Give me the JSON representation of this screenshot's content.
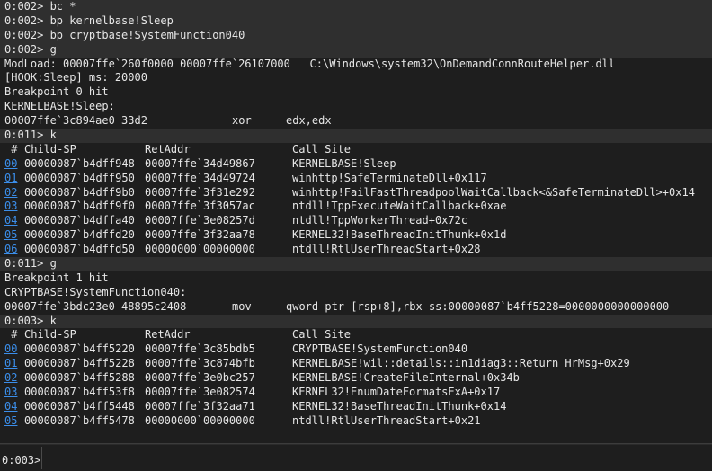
{
  "output": {
    "cmd_bc": "0:002> bc *",
    "cmd_bp_sleep": "0:002> bp kernelbase!Sleep",
    "cmd_bp_sysfunc": "0:002> bp cryptbase!SystemFunction040",
    "cmd_g1": "0:002> g",
    "modload": "ModLoad: 00007ffe`260f0000 00007ffe`26107000   C:\\Windows\\system32\\OnDemandConnRouteHelper.dll",
    "hook_sleep": "[HOOK:Sleep] ms: 20000",
    "bp0_hit": "Breakpoint 0 hit",
    "sleep_symbol": "KERNELBASE!Sleep:",
    "disasm1": {
      "address": "00007ffe`3c894ae0 33d2",
      "mnemonic": "xor",
      "operands": "edx,edx"
    },
    "cmd_k1": "0:011> k",
    "cmd_g2": "0:011> g",
    "bp1_hit": "Breakpoint 1 hit",
    "sysfunc_symbol": "CRYPTBASE!SystemFunction040:",
    "disasm2": {
      "address": "00007ffe`3bdc23e0 48895c2408",
      "mnemonic": "mov",
      "operands": "qword ptr [rsp+8],rbx ss:00000087`b4ff5228=0000000000000000"
    },
    "cmd_k2": "0:003> k"
  },
  "stack1": {
    "headers": {
      "num": " #",
      "child_sp": "Child-SP",
      "ret_addr": "RetAddr",
      "call_site": "Call Site"
    },
    "frames": [
      {
        "num": "00",
        "child_sp": "00000087`b4dff948",
        "ret_addr": "00007ffe`34d49867",
        "call_site": "KERNELBASE!Sleep"
      },
      {
        "num": "01",
        "child_sp": "00000087`b4dff950",
        "ret_addr": "00007ffe`34d49724",
        "call_site": "winhttp!SafeTerminateDll+0x117"
      },
      {
        "num": "02",
        "child_sp": "00000087`b4dff9b0",
        "ret_addr": "00007ffe`3f31e292",
        "call_site": "winhttp!FailFastThreadpoolWaitCallback<&SafeTerminateDll>+0x14"
      },
      {
        "num": "03",
        "child_sp": "00000087`b4dff9f0",
        "ret_addr": "00007ffe`3f3057ac",
        "call_site": "ntdll!TppExecuteWaitCallback+0xae"
      },
      {
        "num": "04",
        "child_sp": "00000087`b4dffa40",
        "ret_addr": "00007ffe`3e08257d",
        "call_site": "ntdll!TppWorkerThread+0x72c"
      },
      {
        "num": "05",
        "child_sp": "00000087`b4dffd20",
        "ret_addr": "00007ffe`3f32aa78",
        "call_site": "KERNEL32!BaseThreadInitThunk+0x1d"
      },
      {
        "num": "06",
        "child_sp": "00000087`b4dffd50",
        "ret_addr": "00000000`00000000",
        "call_site": "ntdll!RtlUserThreadStart+0x28"
      }
    ]
  },
  "stack2": {
    "headers": {
      "num": " #",
      "child_sp": "Child-SP",
      "ret_addr": "RetAddr",
      "call_site": "Call Site"
    },
    "frames": [
      {
        "num": "00",
        "child_sp": "00000087`b4ff5220",
        "ret_addr": "00007ffe`3c85bdb5",
        "call_site": "CRYPTBASE!SystemFunction040"
      },
      {
        "num": "01",
        "child_sp": "00000087`b4ff5228",
        "ret_addr": "00007ffe`3c874bfb",
        "call_site": "KERNELBASE!wil::details::in1diag3::Return_HrMsg+0x29"
      },
      {
        "num": "02",
        "child_sp": "00000087`b4ff5288",
        "ret_addr": "00007ffe`3e0bc257",
        "call_site": "KERNELBASE!CreateFileInternal+0x34b"
      },
      {
        "num": "03",
        "child_sp": "00000087`b4ff53f8",
        "ret_addr": "00007ffe`3e082574",
        "call_site": "KERNEL32!EnumDateFormatsExA+0x17"
      },
      {
        "num": "04",
        "child_sp": "00000087`b4ff5448",
        "ret_addr": "00007ffe`3f32aa71",
        "call_site": "KERNEL32!BaseThreadInitThunk+0x14"
      },
      {
        "num": "05",
        "child_sp": "00000087`b4ff5478",
        "ret_addr": "00000000`00000000",
        "call_site": "ntdll!RtlUserThreadStart+0x21"
      }
    ]
  },
  "command_bar": {
    "prompt": "0:003>",
    "value": ""
  },
  "colors": {
    "background": "#1e1e1e",
    "command_highlight": "#2f2f2f",
    "text": "#e6e6e6",
    "link": "#3b8eea"
  }
}
